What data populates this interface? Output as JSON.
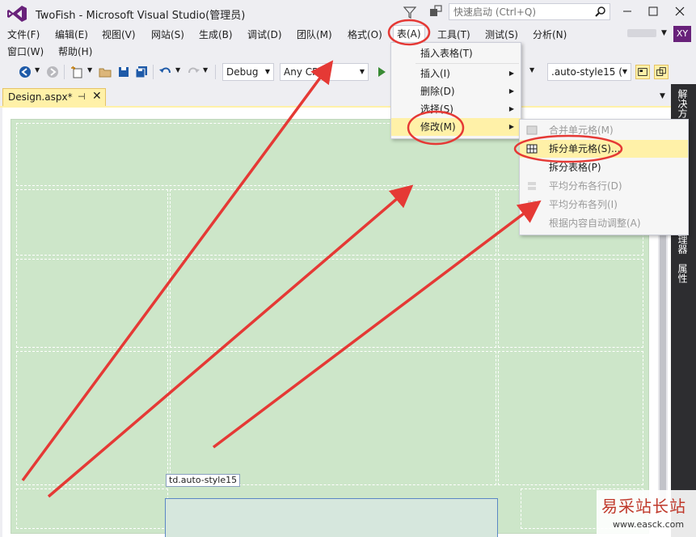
{
  "window": {
    "title": "TwoFish - Microsoft Visual Studio(管理员)",
    "quick_launch_placeholder": "快速启动 (Ctrl+Q)",
    "user_initials": "XY"
  },
  "menubar": {
    "row1": [
      "文件(F)",
      "编辑(E)",
      "视图(V)",
      "网站(S)",
      "生成(B)",
      "调试(D)",
      "团队(M)",
      "格式(O)",
      "表(A)",
      "工具(T)",
      "测试(S)",
      "分析(N)"
    ],
    "row2": [
      "窗口(W)",
      "帮助(H)"
    ]
  },
  "toolbar": {
    "config": "Debug",
    "platform": "Any CPU",
    "style_target": ".auto-style15 ( "
  },
  "document_tab": {
    "label": "Design.aspx*",
    "pin": "⊣",
    "close": "✕"
  },
  "side_dock": {
    "labels": [
      "解决方",
      "理器",
      "属性"
    ]
  },
  "design": {
    "selected_tag": "td.auto-style15"
  },
  "table_menu": {
    "items": [
      {
        "label": "插入表格(T)",
        "submenu": false
      },
      {
        "label": "插入(I)",
        "submenu": true
      },
      {
        "label": "删除(D)",
        "submenu": true
      },
      {
        "label": "选择(S)",
        "submenu": true
      },
      {
        "label": "修改(M)",
        "submenu": true
      }
    ]
  },
  "modify_menu": {
    "items": [
      {
        "label": "合并单元格(M)",
        "enabled": false
      },
      {
        "label": "拆分单元格(S)...",
        "enabled": true
      },
      {
        "label": "拆分表格(P)",
        "enabled": true
      },
      {
        "label": "平均分布各行(D)",
        "enabled": false
      },
      {
        "label": "平均分布各列(I)",
        "enabled": false
      },
      {
        "label": "根据内容自动调整(A)",
        "enabled": false
      }
    ]
  },
  "colors": {
    "accent_purple": "#68217a",
    "tab_active": "#fff1a8",
    "design_green": "#cde6c9",
    "annotation_red": "#e53935"
  },
  "watermark": {
    "text": "易采站长站",
    "url": "www.easck.com"
  }
}
